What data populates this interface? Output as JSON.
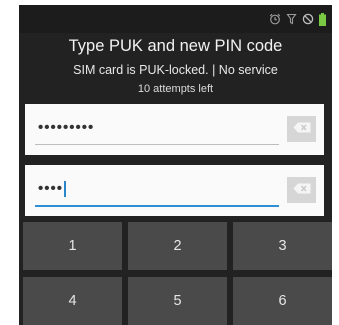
{
  "status_bar": {
    "icons": [
      "alarm-icon",
      "vibrate-icon",
      "no-signal-icon",
      "battery-icon"
    ],
    "battery_color": "#7ac943"
  },
  "header": {
    "title": "Type PUK and new PIN code",
    "subtitle": "SIM card is PUK-locked. | No service",
    "attempts": "10 attempts left"
  },
  "puk_field": {
    "value": "•••••••••"
  },
  "pin_field": {
    "value": "••••"
  },
  "keypad": {
    "keys": [
      "1",
      "2",
      "3",
      "4",
      "5",
      "6"
    ]
  },
  "colors": {
    "screen_bg": "#222222",
    "key_bg": "#4a4a4a",
    "field_bg": "#fafafa",
    "accent": "#2f8fd6"
  }
}
